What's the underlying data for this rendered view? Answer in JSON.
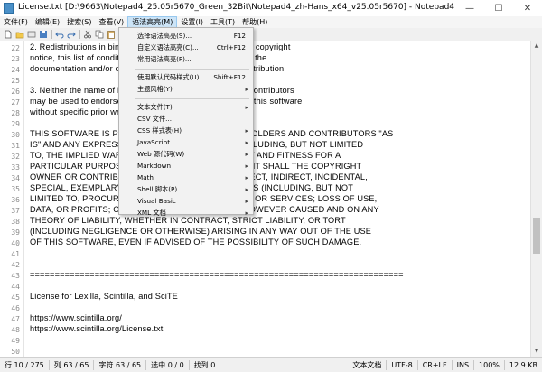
{
  "window": {
    "title": "License.txt [D:\\9663\\Notepad4_25.05r5670_Green_32Bit\\Notepad4_zh-Hans_x64_v25.05r5670] - Notepad4",
    "minimize": "—",
    "maximize": "☐",
    "close": "✕"
  },
  "menu": [
    "文件(F)",
    "编辑(E)",
    "搜索(S)",
    "查看(V)",
    "语法高亮(M)",
    "设置(I)",
    "工具(T)",
    "帮助(H)"
  ],
  "toolbar_icons": [
    "new-file-icon",
    "open-file-icon",
    "browse-icon",
    "save-icon",
    "undo-icon",
    "redo-icon",
    "cut-icon",
    "copy-icon",
    "paste-icon",
    "find-icon",
    "replace-icon",
    "zoom-in-icon",
    "zoom-out-icon",
    "word-wrap-icon",
    "scheme-icon",
    "settings-icon",
    "close-icon",
    "refresh-icon"
  ],
  "lines": [
    {
      "num": "22",
      "text": "2. Redistributions in binary form must reproduce the above copyright"
    },
    {
      "num": "23",
      "text": "notice, this list of conditions and the following disclaimer in the"
    },
    {
      "num": "24",
      "text": "documentation and/or other materials provided with the distribution."
    },
    {
      "num": "25",
      "text": ""
    },
    {
      "num": "26",
      "text": "3. Neither the name of Neil Hodgson nor the names of its contributors"
    },
    {
      "num": "27",
      "text": "may be used to endorse or promote products derived from this software"
    },
    {
      "num": "28",
      "text": "without specific prior written permission."
    },
    {
      "num": "29",
      "text": ""
    },
    {
      "num": "30",
      "text": "THIS SOFTWARE IS PROVIDED BY THE COPYRIGHT HOLDERS AND CONTRIBUTORS \"AS"
    },
    {
      "num": "31",
      "text": "IS\" AND ANY EXPRESS OR IMPLIED WARRANTIES, INCLUDING, BUT NOT LIMITED"
    },
    {
      "num": "32",
      "text": "TO, THE IMPLIED WARRANTIES OF MERCHANTABILITY AND FITNESS FOR A"
    },
    {
      "num": "33",
      "text": "PARTICULAR PURPOSE ARE DISCLAIMED. IN NO EVENT SHALL THE COPYRIGHT"
    },
    {
      "num": "34",
      "text": "OWNER OR CONTRIBUTORS BE LIABLE FOR ANY DIRECT, INDIRECT, INCIDENTAL,"
    },
    {
      "num": "35",
      "text": "SPECIAL, EXEMPLARY, OR CONSEQUENTIAL DAMAGES (INCLUDING, BUT NOT"
    },
    {
      "num": "36",
      "text": "LIMITED TO, PROCUREMENT OF SUBSTITUTE GOODS OR SERVICES; LOSS OF USE,"
    },
    {
      "num": "37",
      "text": "DATA, OR PROFITS; OR BUSINESS INTERRUPTION) HOWEVER CAUSED AND ON ANY"
    },
    {
      "num": "38",
      "text": "THEORY OF LIABILITY, WHETHER IN CONTRACT, STRICT LIABILITY, OR TORT"
    },
    {
      "num": "39",
      "text": "(INCLUDING NEGLIGENCE OR OTHERWISE) ARISING IN ANY WAY OUT OF THE USE"
    },
    {
      "num": "40",
      "text": "OF THIS SOFTWARE, EVEN IF ADVISED OF THE POSSIBILITY OF SUCH DAMAGE."
    },
    {
      "num": "41",
      "text": ""
    },
    {
      "num": "42",
      "text": ""
    },
    {
      "num": "43",
      "text": "==========================================================================="
    },
    {
      "num": "44",
      "text": ""
    },
    {
      "num": "45",
      "text": "License for Lexilla, Scintilla, and SciTE"
    },
    {
      "num": "46",
      "text": ""
    },
    {
      "num": "47",
      "text": "https://www.scintilla.org/"
    },
    {
      "num": "48",
      "text": "https://www.scintilla.org/License.txt"
    },
    {
      "num": "49",
      "text": ""
    },
    {
      "num": "50",
      "text": ""
    }
  ],
  "dropdown": {
    "items": [
      {
        "label": "选择语法高亮(S)...",
        "shortcut": "F12",
        "submenu": false
      },
      {
        "label": "自定义语法高亮(C)...",
        "shortcut": "Ctrl+F12",
        "submenu": false
      },
      {
        "label": "常用语法高亮(F)...",
        "shortcut": "",
        "submenu": false
      },
      {
        "sep": true
      },
      {
        "label": "使用默认代码样式(U)",
        "shortcut": "Shift+F12",
        "submenu": false
      },
      {
        "label": "主题风格(Y)",
        "shortcut": "",
        "submenu": true
      },
      {
        "sep": true
      },
      {
        "label": "文本文件(T)",
        "shortcut": "",
        "submenu": true
      },
      {
        "label": "CSV 文件...",
        "shortcut": "",
        "submenu": false
      },
      {
        "label": "CSS 样式表(H)",
        "shortcut": "",
        "submenu": true
      },
      {
        "label": "JavaScript",
        "shortcut": "",
        "submenu": true
      },
      {
        "label": "Web 源代码(W)",
        "shortcut": "",
        "submenu": true
      },
      {
        "label": "Markdown",
        "shortcut": "",
        "submenu": true
      },
      {
        "label": "Math",
        "shortcut": "",
        "submenu": true
      },
      {
        "label": "Shell 脚本(P)",
        "shortcut": "",
        "submenu": true
      },
      {
        "label": "Visual Basic",
        "shortcut": "",
        "submenu": true
      },
      {
        "label": "XML 文档",
        "shortcut": "",
        "submenu": true
      }
    ],
    "arrow": "▸"
  },
  "status": {
    "line": "行 10 / 275",
    "col": "列 63 / 65",
    "char": "字符 63 / 65",
    "sel": "选中 0 / 0",
    "find": "找到 0",
    "type": "文本文档",
    "enc": "UTF-8",
    "eol": "CR+LF",
    "ins": "INS",
    "zoom": "100%",
    "size": "12.9 KB"
  },
  "colors": {
    "menu_highlight": "#cce4f7",
    "gutter_text": "#8a8a8a"
  }
}
